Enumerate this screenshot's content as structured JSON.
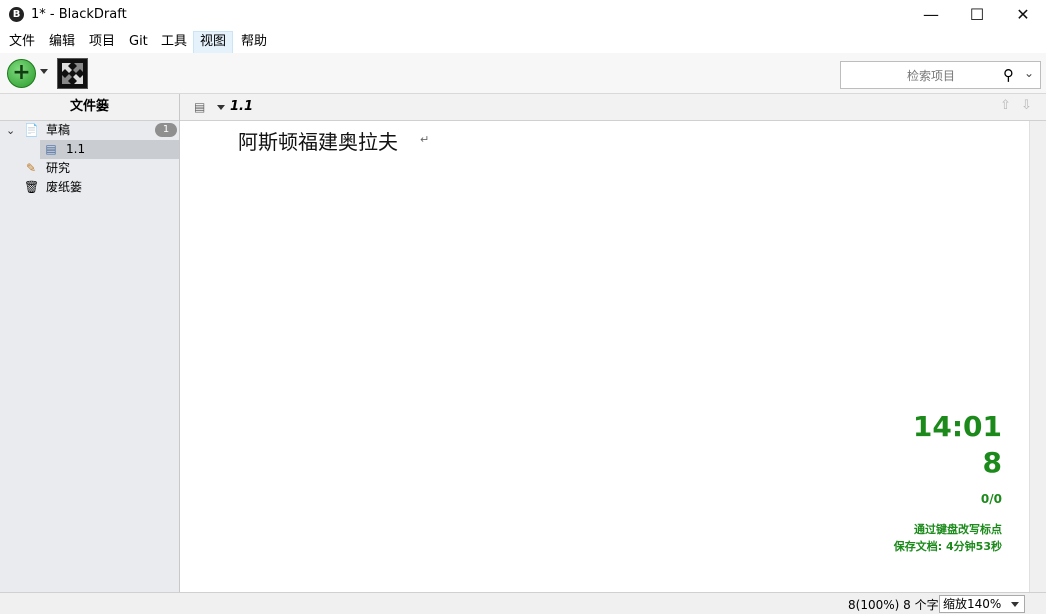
{
  "window": {
    "app_icon": "B",
    "title": "1* - BlackDraft",
    "minimize_glyph": "—",
    "maximize_glyph": "☐",
    "close_glyph": "✕"
  },
  "menu": {
    "items": [
      "文件",
      "编辑",
      "项目",
      "Git",
      "工具",
      "视图",
      "帮助"
    ],
    "active_index": 5
  },
  "toolbar": {
    "add_glyph": "+",
    "add_icon": "plus-circle-icon",
    "fullscreen_icon": "fullscreen-icon"
  },
  "search": {
    "placeholder": "检索项目",
    "icon_glyph": "⚲",
    "chevron_glyph": "⌄"
  },
  "binder": {
    "header": "文件篓",
    "twisty_glyph": "⌄",
    "items": [
      {
        "label": "草稿",
        "icon": "draft-folder-icon",
        "icon_glyph": "📄",
        "badge": "1"
      },
      {
        "label": "1.1",
        "icon": "document-icon",
        "icon_glyph": "▤",
        "selected": true
      },
      {
        "label": "研究",
        "icon": "tools-icon",
        "icon_glyph": "✎"
      },
      {
        "label": "废纸篓",
        "icon": "trash-icon",
        "icon_glyph": "🗑"
      }
    ]
  },
  "editor": {
    "header_title": "1.1",
    "header_icon_glyph": "▤",
    "nav_up_glyph": "⇧",
    "nav_down_glyph": "⇩",
    "text": "阿斯顿福建奥拉夫",
    "pilcrow": "↵"
  },
  "stats": {
    "time": "14:01",
    "word_count": "8",
    "target_ratio": "0/0",
    "hint": "通过键盘改写标点",
    "save_status": "保存文档: 4分钟53秒",
    "color": "#1b8a1b"
  },
  "status_bar": {
    "words": "8(100%)  8 个字",
    "zoom": "缩放140%"
  }
}
